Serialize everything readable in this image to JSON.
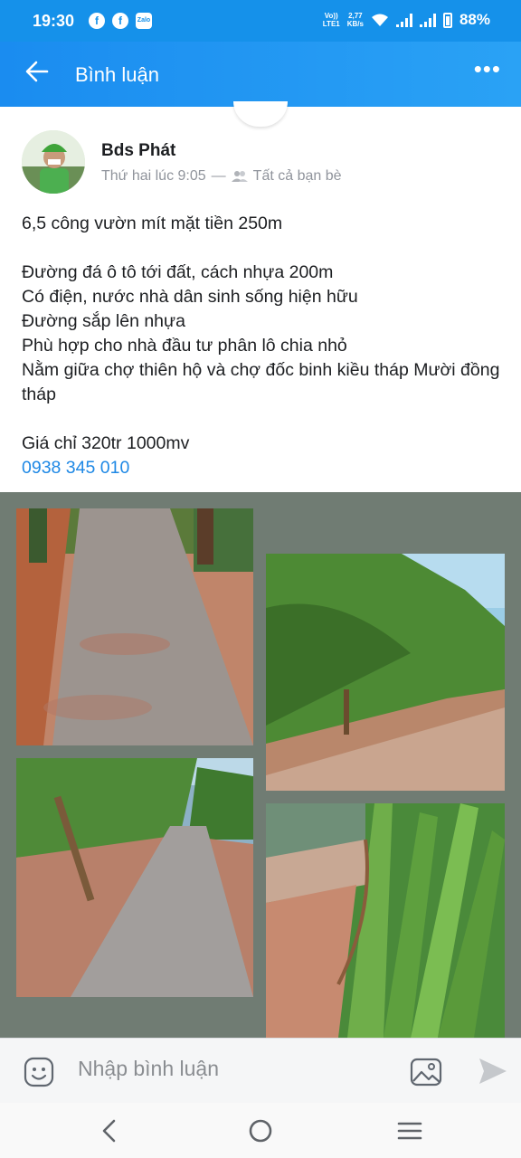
{
  "status_bar": {
    "time": "19:30",
    "app_icons": [
      "facebook-icon",
      "facebook-icon",
      "zalo-icon"
    ],
    "network_label_top": "Vo))",
    "network_label_bottom": "LTE1",
    "speed_top": "2,77",
    "speed_bottom": "KB/s",
    "battery": "88%"
  },
  "app_bar": {
    "title": "Bình luận",
    "back_icon": "arrow-left-icon",
    "more_label": "•••"
  },
  "post": {
    "author": "Bds Phát",
    "timestamp": "Thứ hai lúc 9:05",
    "separator": "—",
    "audience": "Tất cả bạn bè",
    "lines": [
      "6,5 công vườn mít mặt tiền 250m",
      "",
      "Đường đá ô tô tới đất, cách nhựa 200m",
      "Có điện, nước nhà dân sinh sống hiện hữu",
      "Đường sắp lên nhựa",
      "Phù hợp cho nhà đầu tư phân lô chia nhỏ",
      "Nằm giữa chợ thiên hộ và chợ đốc binh kiều tháp Mười đồng tháp",
      "",
      "Giá chỉ 320tr 1000mv"
    ],
    "phone": "0938 345 010"
  },
  "composer": {
    "placeholder": "Nhập bình luận",
    "emoji_icon": "emoji-icon",
    "image_icon": "image-icon",
    "send_icon": "send-icon"
  },
  "nav_bar": {
    "back_icon": "nav-back-icon",
    "home_icon": "nav-home-icon",
    "recents_icon": "nav-menu-icon"
  },
  "colors": {
    "header_blue": "#1a8cf0",
    "link_blue": "#1e88e5",
    "gallery_bg": "#707c73"
  }
}
